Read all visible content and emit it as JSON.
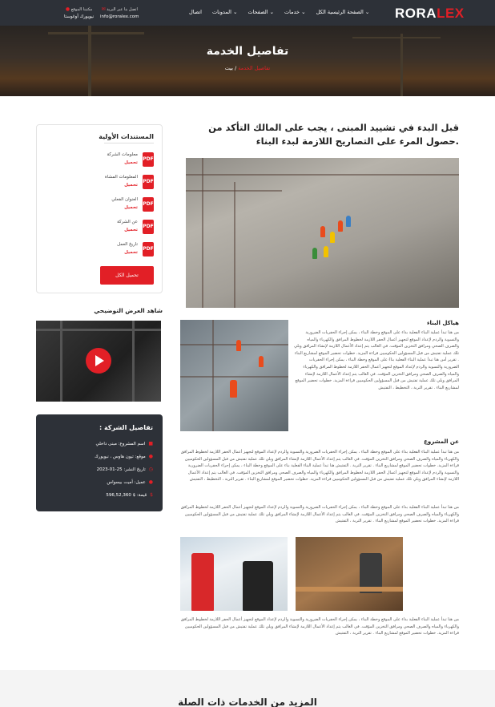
{
  "header": {
    "logo_main": "RORA",
    "logo_accent": "LEX",
    "nav": [
      "الصفحة الرئيسية الكل ⌄",
      "خدمات ⌄",
      "الصفحات ⌄",
      "المدونات ⌄",
      "اتصال"
    ],
    "contact": [
      {
        "label": "اتصل بنا عبر البريد",
        "value": "info@roralex.com"
      },
      {
        "label": "مكتبنا الموقع",
        "value": "نيويورك أوغوستا"
      }
    ]
  },
  "hero": {
    "title": "تفاصيل الخدمة",
    "crumb_home": "بيت",
    "crumb_current": "تفاصيل الخدمة"
  },
  "docs": {
    "title": "المستندات الأولية",
    "items": [
      {
        "name": "معلومات الشركة",
        "action": "تحميل"
      },
      {
        "name": "المعلومات المشاة",
        "action": "تحميل"
      },
      {
        "name": "العنوان الفعلي",
        "action": "تحميل"
      },
      {
        "name": "عن الشركة",
        "action": "تحميل"
      },
      {
        "name": "تاريخ العمل",
        "action": "تحميل"
      }
    ],
    "button": "تحميل الكل"
  },
  "video": {
    "title": "شاهد العرض التوضيحي"
  },
  "info": {
    "title": ": تفاصيل الشركة",
    "rows": [
      "اسم المشروع: مبنى داخلي",
      "موقع: تيون هاوس ، نيويورك",
      "تاريخ النشر: 25-01-2023",
      "عميل: أميت بيسواس",
      "قيمة: $ 596,52,360"
    ]
  },
  "main": {
    "title": "قبل البدء في تشييد المبنى ، يجب على المالك التأكد من حصول المرء على التصاريح اللازمة لبدء البناء.",
    "section1_title": "هياكل البناء",
    "section1_text": "من هنا تبدأ عملية البناء الفعلية بداء على الموقع وخطة البناء ، يمكن إجراء الحفريات الضرورية والتسوية والردم لإعداد الموقع لتجهيز أعمال الحفر اللازمة لخطوط المرافق والكهرباء والمياه والصرف الصحي ومرافق التخزين المؤقت. في الغالب يتم إعداد الأعمال اللازمة لإنشاء المرافق ويلي تلك عملية تفتيش من قبل المسؤولين الحكوميين قراءة المزيد. خطوات تحضير الموقع لمشاريع البناء . تقرير أمن هنا تبدأ عملية البناء الفعلية بناءً على الموقع وخطة البناء ، يمكن إجراء الحفريات الضرورية والتسوية والردم لإعداد الموقع لتجهيز أعمال الحفر اللازمة لخطوط المرافق والكهرباء والمياه والصرف الصحي ومرافق التخزين المؤقت. في الغالب يتم إعداد الأعمال اللازمة لإنشاء المرافق ويلي تلك عملية تفتيش من قبل المسؤولين الحكوميين قراءة المزيد. خطوات تحضير الموقع لمشاريع البناء . تقرير التربة ، التخطيط ، التفتيش",
    "section2_title": "عن المشروع",
    "section2_text1": "من هنا تبدأ عملية البناء الفعلية بداء على الموقع وخطة البناء ، يمكن إجراء الحفريات الضرورية والتسوية والردم لإعداد الموقع لتجهيز أعمال الحفر اللازمة لخطوط المرافق والكهرباء والمياه والصرف الصحي ومرافق التخزين المؤقت. في الغالب يتم إعداد الأعمال اللازمة لإنشاء المرافق ويلي تلك عملية تفتيش من قبل المسؤولين الحكوميين قراءة المزيد. خطوات تحضير الموقع لمشاريع البناء . تقرير التربة . التفتيش هنا تبدأ عملية البناء الفعلية بناء على الموقع وخطة البناء ، يمكن إجراء الحفريات الضرورية والتسوية والردم لإعداد الموقع لتجهيز أعمال الحفر اللازمة لخطوط المرافق والكهرباء والمياه والصرف الصحي ومرافق التخزين المؤقت. في الغالب يتم إعداد الأعمال اللازمة لإنشاء المرافق ويلي تلك عملية تفتيش من قبل المسؤولين الحكوميين قراءة المزيد. خطوات تحضير الموقع لمشاريع البناء . تقرير التربة ، التخطيط ، التفتيش",
    "section2_text2": "من هنا تبدأ عملية البناء الفعلية بداء على الموقع وخطة البناء ، يمكن إجراء الحفريات الضرورية والتسوية والردم لإعداد الموقع لتجهيز أعمال الحفر اللازمة لخطوط المرافق والكهرباء والمياه والصرف الصحي ومرافق التخزين المؤقت. في الغالب يتم إعداد الأعمال اللازمة لإنشاء المرافق ويلي تلك عملية تفتيش من قبل المسؤولين الحكوميين قراءة المزيد. خطوات تحضير الموقع لمشاريع البناء . تقرير التربة ، التفتيش",
    "section3_text": "من هنا تبدأ عملية البناء الفعلية بداء على الموقع وخطة البناء ، يمكن إجراء الحفريات الضرورية والتسوية والردم لإعداد الموقع لتجهيز أعمال الحفر اللازمة لخطوط المرافق والكهرباء والمياه والصرف الصحي ومرافق التخزين المؤقت. في الغالب يتم إعداد الأعمال اللازمة لإنشاء المرافق ويلي تلك عملية تفتيش من قبل المسؤولين الحكوميين قراءة المزيد. خطوات تحضير الموقع لمشاريع البناء . تقرير التربة ، التفتيش"
  },
  "related": {
    "title": "المزيد من الخدمات ذات الصلة"
  },
  "colors": {
    "accent": "#e21f26",
    "dark": "#2d3138"
  }
}
